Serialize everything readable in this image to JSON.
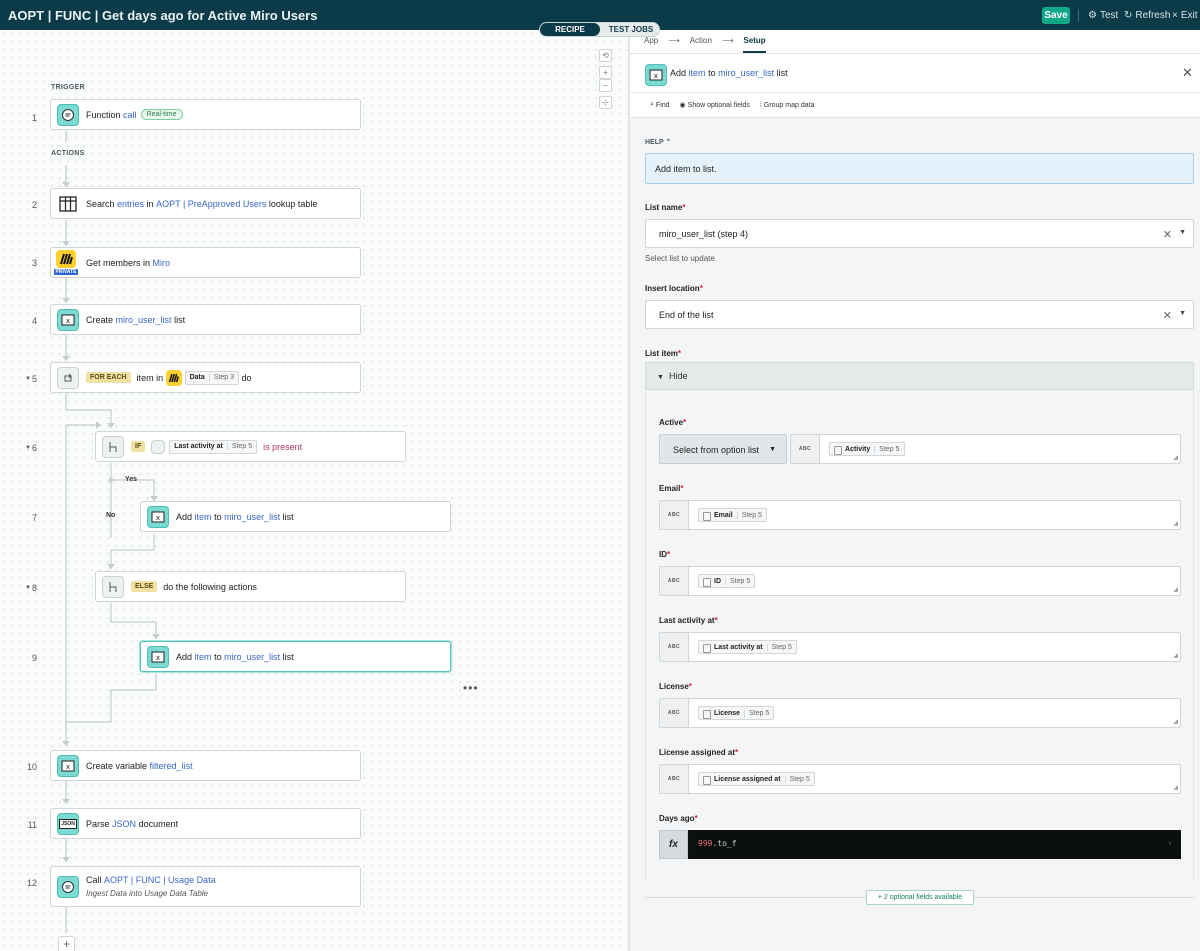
{
  "app": {
    "title": "AOPT | FUNC | Get days ago for Active Miro Users",
    "save_label": "Save",
    "test_label": "Test",
    "refresh_label": "Refresh",
    "exit_label": "Exit",
    "tab_recipe": "RECIPE",
    "tab_test_jobs": "TEST JOBS"
  },
  "recipe": {
    "trigger_label": "TRIGGER",
    "actions_label": "ACTIONS",
    "yes_label": "Yes",
    "no_label": "No",
    "steps": [
      {
        "num": "1",
        "pre": "Function",
        "link": "call",
        "badge": "Real-time"
      },
      {
        "num": "2",
        "pre": "Search",
        "link1": "entries",
        "mid1": "in",
        "link2": "AOPT | PreApproved Users",
        "post": "lookup table"
      },
      {
        "num": "3",
        "pre": "Get members in",
        "link": "Miro",
        "private_badge": "PRIVATE"
      },
      {
        "num": "4",
        "pre": "Create",
        "link": "miro_user_list",
        "post": "list"
      },
      {
        "num": "5",
        "keyword": "FOR EACH",
        "mid": "item in",
        "pill_name": "Data",
        "pill_step": "Step 3",
        "post": "do"
      },
      {
        "num": "6",
        "keyword": "IF",
        "pill_name": "Last activity at",
        "pill_step": "Step 5",
        "condition": "is present"
      },
      {
        "num": "7",
        "pre": "Add",
        "link1": "item",
        "mid": "to",
        "link2": "miro_user_list",
        "post": "list"
      },
      {
        "num": "8",
        "keyword": "ELSE",
        "post": "do the following actions"
      },
      {
        "num": "9",
        "pre": "Add",
        "link1": "item",
        "mid": "to",
        "link2": "miro_user_list",
        "post": "list"
      },
      {
        "num": "10",
        "pre": "Create variable",
        "link": "filtered_list"
      },
      {
        "num": "11",
        "pre": "Parse",
        "link": "JSON",
        "post": "document",
        "icon_text": "JSON"
      },
      {
        "num": "12",
        "pre": "Call",
        "link": "AOPT | FUNC | Usage Data",
        "subtitle": "Ingest Data into Usage Data Table"
      }
    ],
    "add_step": "+"
  },
  "panel": {
    "breadcrumb": [
      "App",
      "Action",
      "Setup"
    ],
    "title_pre": "Add",
    "title_link1": "item",
    "title_mid": "to",
    "title_link2": "miro_user_list",
    "title_post": "list",
    "toolbar": {
      "find": "Find",
      "optional": "Show optional fields",
      "group_map": "Group map data"
    },
    "help_label": "HELP",
    "help_text": "Add item to list.",
    "list_name_label": "List name",
    "list_name_value": "miro_user_list (step 4)",
    "list_name_hint": "Select list to update",
    "insert_location_label": "Insert location",
    "insert_location_value": "End of the list",
    "list_item_label": "List item",
    "hide_label": "Hide",
    "abc": "ABC",
    "fields": {
      "active": {
        "label": "Active",
        "option": "Select from option list",
        "pill": "Activity",
        "step": "Step 5"
      },
      "email": {
        "label": "Email",
        "pill": "Email",
        "step": "Step 5"
      },
      "id": {
        "label": "ID",
        "pill": "ID",
        "step": "Step 5"
      },
      "last_activity": {
        "label": "Last activity at",
        "pill": "Last activity at",
        "step": "Step 5"
      },
      "license": {
        "label": "License",
        "pill": "License",
        "step": "Step 5"
      },
      "license_assigned": {
        "label": "License assigned at",
        "pill": "License assigned at",
        "step": "Step 5"
      },
      "days_ago": {
        "label": "Days ago",
        "fx": "fx",
        "code_num": "999",
        "code_method": ".to_f"
      }
    },
    "optional_fields": "+ 2 optional fields available"
  }
}
